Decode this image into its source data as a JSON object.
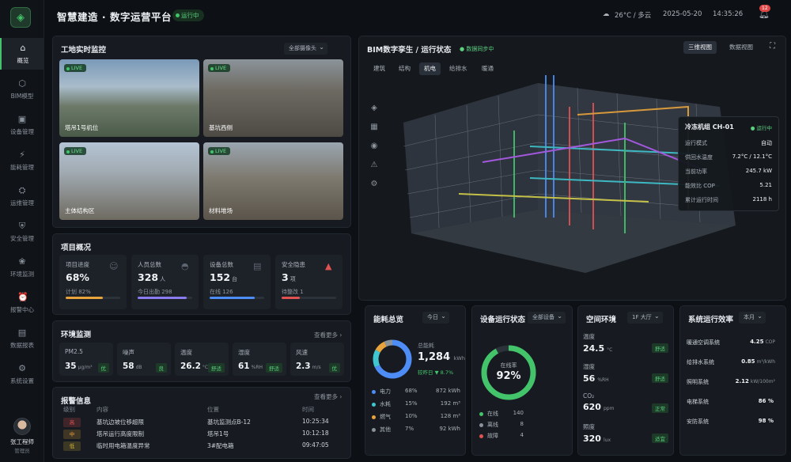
{
  "app": {
    "title": "智慧建造 · 数字运营平台",
    "status": "运行中",
    "weather": "26°C / 多云",
    "date": "2025-05-20",
    "time": "14:35:26",
    "notif_count": "12"
  },
  "nav": [
    {
      "label": "概览",
      "icon": "home-icon"
    },
    {
      "label": "BIM模型",
      "icon": "cube-icon"
    },
    {
      "label": "设备管理",
      "icon": "device-icon"
    },
    {
      "label": "能耗管理",
      "icon": "energy-icon"
    },
    {
      "label": "运维管理",
      "icon": "toolbox-icon"
    },
    {
      "label": "安全管理",
      "icon": "shield-icon"
    },
    {
      "label": "环境监测",
      "icon": "leaf-icon"
    },
    {
      "label": "报警中心",
      "icon": "alarm-icon"
    },
    {
      "label": "数据报表",
      "icon": "report-icon"
    },
    {
      "label": "系统设置",
      "icon": "gear-icon"
    }
  ],
  "user": {
    "name": "张工程师",
    "role": "管理员"
  },
  "monitor": {
    "title": "工地实时监控",
    "filter": "全部摄像头",
    "live": "LIVE",
    "cams": [
      "塔吊1号机位",
      "基坑西侧",
      "主体结构区",
      "材料堆场"
    ]
  },
  "project": {
    "title": "项目概况",
    "cards": [
      {
        "t": "项目进度",
        "v": "68%",
        "u": "",
        "s": "计划 82%",
        "bar": 0.68,
        "color": "#e8a33c"
      },
      {
        "t": "人员总数",
        "v": "328",
        "u": "人",
        "s": "今日出勤 298",
        "bar": 0.9,
        "color": "#8a7cf0"
      },
      {
        "t": "设备总数",
        "v": "152",
        "u": "台",
        "s": "在线 126",
        "bar": 0.83,
        "color": "#4d8df5"
      },
      {
        "t": "安全隐患",
        "v": "3",
        "u": "项",
        "s": "待整改 1",
        "bar": 0.33,
        "color": "#e05252"
      }
    ]
  },
  "env": {
    "title": "环境监测",
    "more": "查看更多 ›",
    "items": [
      {
        "t": "PM2.5",
        "v": "35",
        "u": "μg/m³",
        "tag": "优"
      },
      {
        "t": "噪声",
        "v": "58",
        "u": "dB",
        "tag": "良"
      },
      {
        "t": "温度",
        "v": "26.2",
        "u": "°C",
        "tag": "舒适"
      },
      {
        "t": "湿度",
        "v": "61",
        "u": "%RH",
        "tag": "舒适"
      },
      {
        "t": "风速",
        "v": "2.3",
        "u": "m/s",
        "tag": "优"
      }
    ]
  },
  "alarms": {
    "title": "报警信息",
    "more": "查看更多 ›",
    "headers": [
      "级别",
      "内容",
      "位置",
      "时间"
    ],
    "rows": [
      {
        "level": "高",
        "content": "基坑边坡位移超限",
        "loc": "基坑监测点B-12",
        "time": "10:25:34",
        "color": "#e05252"
      },
      {
        "level": "中",
        "content": "塔吊运行高度限制",
        "loc": "塔吊1号",
        "time": "10:12:18",
        "color": "#e8a33c"
      },
      {
        "level": "低",
        "content": "临时用电箱温度异常",
        "loc": "3#配电箱",
        "time": "09:47:05",
        "color": "#d4b13a"
      }
    ]
  },
  "bim": {
    "title": "BIM数字孪生 / 运行状态",
    "sync": "数据同步中",
    "tabs": [
      "建筑",
      "结构",
      "机电",
      "给排水",
      "暖通"
    ],
    "active_tab": "机电",
    "views": [
      "三维视图",
      "数据视图"
    ]
  },
  "chiller": {
    "title": "冷冻机组 CH-01",
    "status": "运行中",
    "rows": [
      [
        "运行模式",
        "自动"
      ],
      [
        "供回水温度",
        "7.2°C / 12.1°C"
      ],
      [
        "当前功率",
        "245.7 kW"
      ],
      [
        "能效比 COP",
        "5.21"
      ],
      [
        "累计运行时间",
        "2118 h"
      ]
    ]
  },
  "energy": {
    "title": "能耗总览",
    "filter": "今日",
    "total_label": "总能耗",
    "total": "1,284",
    "unit": "kWh",
    "compare": "较昨日 ▼ 8.7%",
    "items": [
      {
        "n": "电力",
        "p": "68%",
        "v": "872 kWh",
        "color": "#4d8df5"
      },
      {
        "n": "水耗",
        "p": "15%",
        "v": "192 m³",
        "color": "#3fc6d0"
      },
      {
        "n": "燃气",
        "p": "10%",
        "v": "128 m³",
        "color": "#e8a33c"
      },
      {
        "n": "其他",
        "p": "7%",
        "v": "92 kWh",
        "color": "#8a929c"
      }
    ]
  },
  "devstat": {
    "title": "设备运行状态",
    "filter": "全部设备",
    "center_label": "在线率",
    "rate": "92%",
    "items": [
      {
        "n": "在线",
        "v": "140",
        "color": "#43c46a"
      },
      {
        "n": "离线",
        "v": "8",
        "color": "#8a929c"
      },
      {
        "n": "故障",
        "v": "4",
        "color": "#e05252"
      }
    ]
  },
  "space": {
    "title": "空间环境",
    "filter": "1F 大厅",
    "items": [
      {
        "t": "温度",
        "v": "24.5",
        "u": "°C",
        "tag": "舒适"
      },
      {
        "t": "湿度",
        "v": "56",
        "u": "%RH",
        "tag": "舒适"
      },
      {
        "t": "CO₂",
        "v": "620",
        "u": "ppm",
        "tag": "正常"
      },
      {
        "t": "照度",
        "v": "320",
        "u": "lux",
        "tag": "适宜"
      }
    ]
  },
  "efficiency": {
    "title": "系统运行效率",
    "filter": "本月",
    "rows": [
      {
        "n": "暖通空调系统",
        "v": "4.25",
        "u": "COP"
      },
      {
        "n": "给排水系统",
        "v": "0.85",
        "u": "m³/kWh"
      },
      {
        "n": "照明系统",
        "v": "2.12",
        "u": "kW/100m²"
      },
      {
        "n": "电梯系统",
        "v": "86 %",
        "u": ""
      },
      {
        "n": "安防系统",
        "v": "98 %",
        "u": ""
      }
    ]
  }
}
